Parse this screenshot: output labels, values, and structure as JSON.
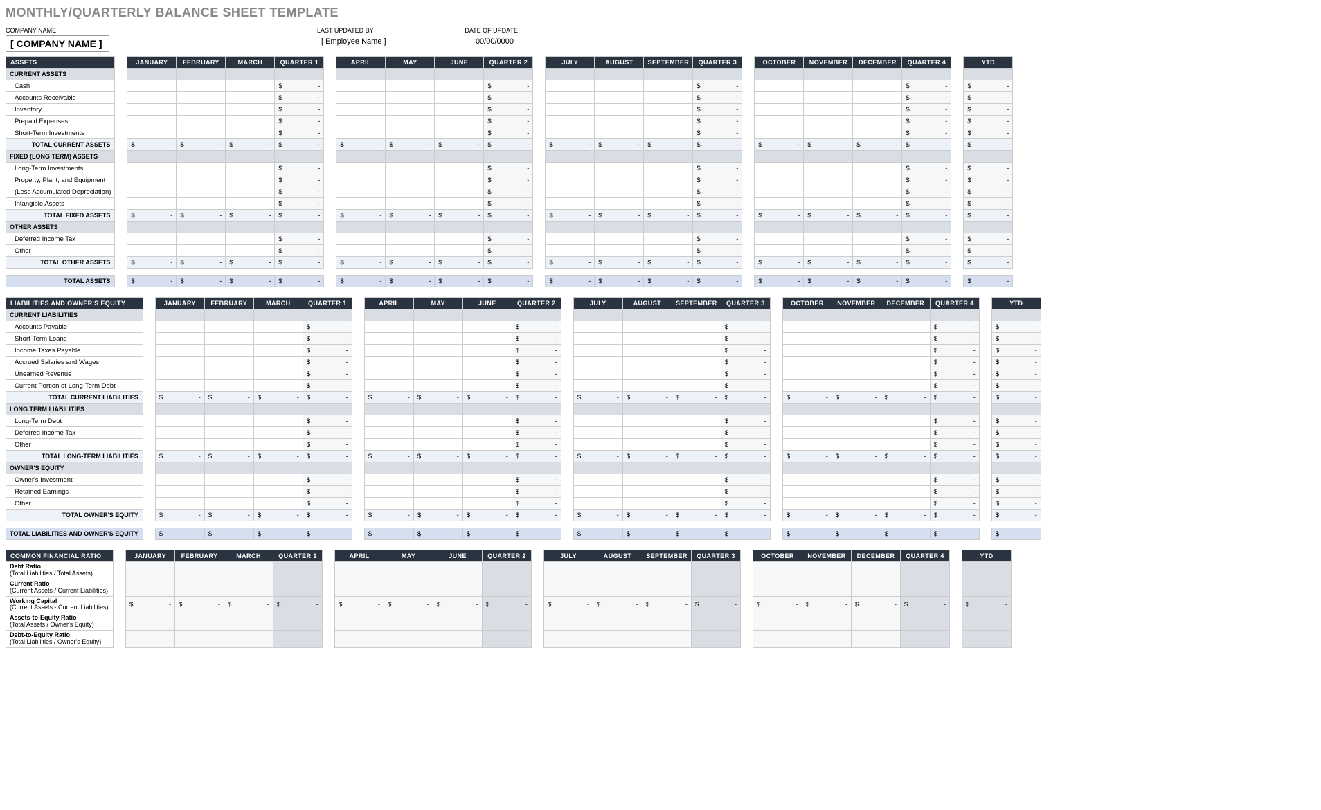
{
  "title": "MONTHLY/QUARTERLY BALANCE SHEET TEMPLATE",
  "meta": {
    "company_label": "COMPANY NAME",
    "company_value": "[ COMPANY NAME ]",
    "updated_by_label": "LAST UPDATED BY",
    "updated_by_value": "[ Employee Name ]",
    "date_label": "DATE OF UPDATE",
    "date_value": "00/00/0000"
  },
  "col_groups": [
    {
      "months": [
        "JANUARY",
        "FEBRUARY",
        "MARCH"
      ],
      "quarter": "QUARTER 1"
    },
    {
      "months": [
        "APRIL",
        "MAY",
        "JUNE"
      ],
      "quarter": "QUARTER 2"
    },
    {
      "months": [
        "JULY",
        "AUGUST",
        "SEPTEMBER"
      ],
      "quarter": "QUARTER 3"
    },
    {
      "months": [
        "OCTOBER",
        "NOVEMBER",
        "DECEMBER"
      ],
      "quarter": "QUARTER 4"
    }
  ],
  "ytd_label": "YTD",
  "currency": "$",
  "dash": "-",
  "sections": {
    "assets": {
      "header": "ASSETS",
      "groups": [
        {
          "name": "CURRENT ASSETS",
          "rows": [
            "Cash",
            "Accounts Receivable",
            "Inventory",
            "Prepaid Expenses",
            "Short-Term Investments"
          ],
          "total": "TOTAL CURRENT ASSETS"
        },
        {
          "name": "FIXED (LONG TERM) ASSETS",
          "rows": [
            "Long-Term Investments",
            "Property, Plant, and Equipment",
            "(Less Accumulated Depreciation)",
            "Intangible Assets"
          ],
          "total": "TOTAL FIXED ASSETS"
        },
        {
          "name": "OTHER ASSETS",
          "rows": [
            "Deferred Income Tax",
            "Other"
          ],
          "total": "TOTAL OTHER ASSETS"
        }
      ],
      "grand_total": "TOTAL ASSETS"
    },
    "liabilities": {
      "header": "LIABILITIES AND OWNER'S EQUITY",
      "groups": [
        {
          "name": "CURRENT LIABILITIES",
          "rows": [
            "Accounts Payable",
            "Short-Term Loans",
            "Income Taxes Payable",
            "Accrued Salaries and Wages",
            "Unearned Revenue",
            "Current Portion of Long-Term Debt"
          ],
          "total": "TOTAL CURRENT LIABILITIES"
        },
        {
          "name": "LONG TERM LIABILITIES",
          "rows": [
            "Long-Term Debt",
            "Deferred Income Tax",
            "Other"
          ],
          "total": "TOTAL LONG-TERM LIABILITIES"
        },
        {
          "name": "OWNER'S EQUITY",
          "rows": [
            "Owner's Investment",
            "Retained Earnings",
            "Other"
          ],
          "total": "TOTAL OWNER'S EQUITY"
        }
      ],
      "grand_total": "TOTAL LIABILITIES AND OWNER'S EQUITY"
    },
    "ratios": {
      "header": "COMMON FINANCIAL RATIO",
      "rows": [
        {
          "main": "Debt Ratio",
          "sub": "(Total Liabilities / Total Assets)",
          "money": false
        },
        {
          "main": "Current Ratio",
          "sub": "(Current Assets / Current Liabilities)",
          "money": false
        },
        {
          "main": "Working Capital",
          "sub": "(Current Assets - Current Liabilities)",
          "money": true
        },
        {
          "main": "Assets-to-Equity Ratio",
          "sub": "(Total Assets / Owner's Equity)",
          "money": false
        },
        {
          "main": "Debt-to-Equity Ratio",
          "sub": "(Total Liabilities / Owner's Equity)",
          "money": false
        }
      ]
    }
  }
}
